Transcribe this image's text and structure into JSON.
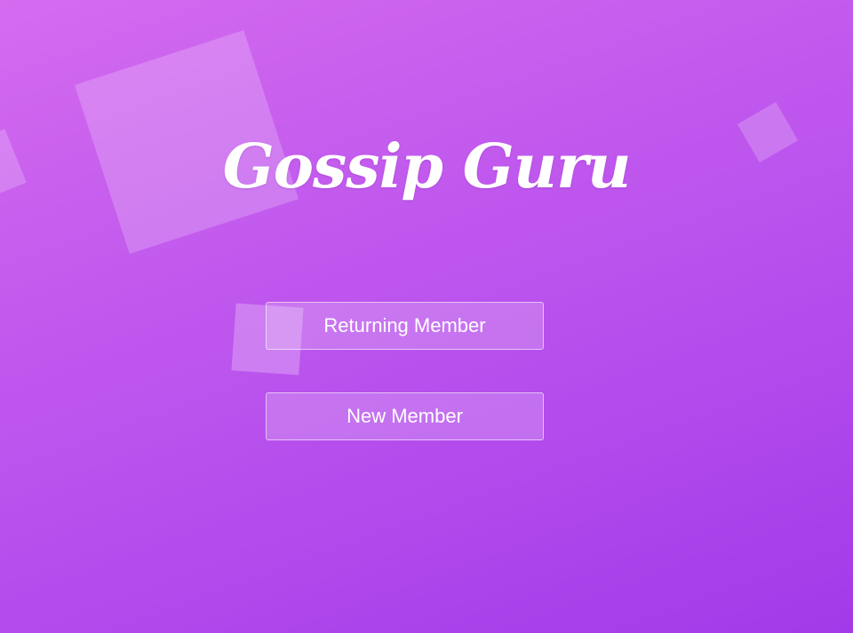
{
  "app": {
    "title": "Gossip Guru"
  },
  "buttons": {
    "returning_label": "Returning Member",
    "new_label": "New Member"
  },
  "colors": {
    "background_start": "#d56bef",
    "background_end": "#a23ae9",
    "text": "#ffffff"
  }
}
